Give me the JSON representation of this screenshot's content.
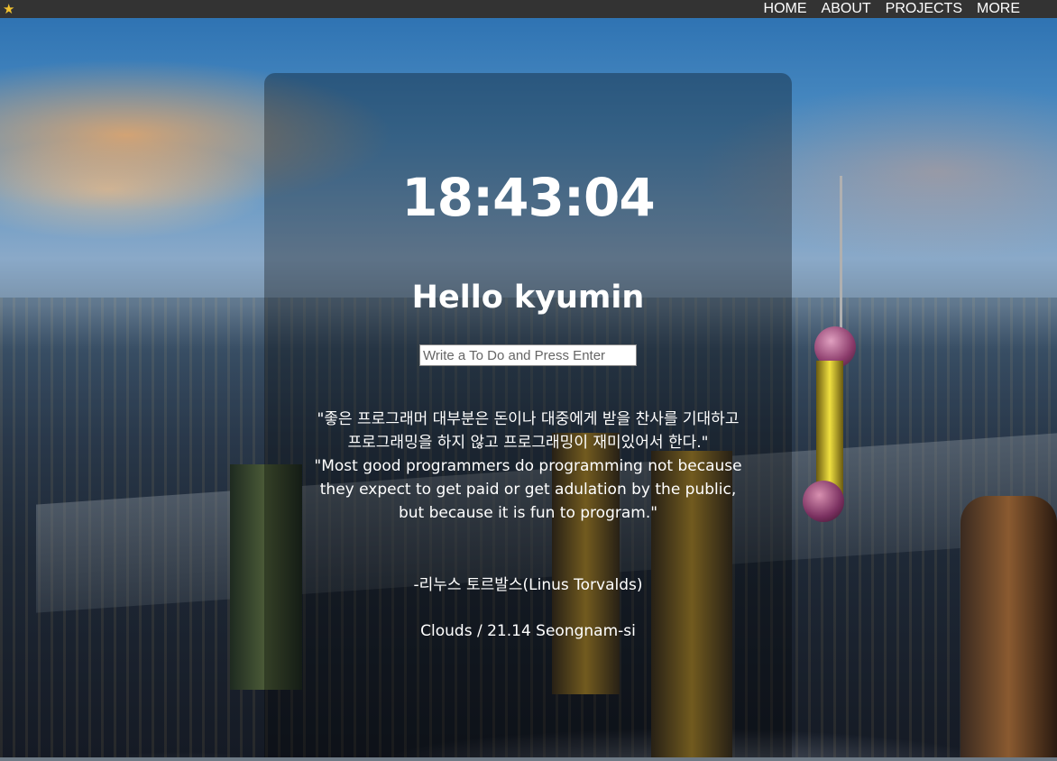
{
  "nav": {
    "logo_icon": "star-icon",
    "logo_color": "#f2c230",
    "links": [
      "HOME",
      "ABOUT",
      "PROJECTS",
      "MORE"
    ]
  },
  "clock": {
    "time": "18:43:04"
  },
  "greeting": {
    "text": "Hello kyumin"
  },
  "todo": {
    "placeholder": "Write a To Do and Press Enter",
    "value": ""
  },
  "quote": {
    "korean": "\"좋은 프로그래머 대부분은 돈이나 대중에게 받을 찬사를 기대하고 프로그래밍을 하지 않고 프로그래밍이 재미있어서 한다.\"",
    "english": "\"Most good programmers do programming not because they expect to get paid or get adulation by the public, but because it is fun to program.\"",
    "author": "-리누스 토르발스(Linus Torvalds)"
  },
  "weather": {
    "text": "Clouds / 21.14 Seongnam-si"
  }
}
